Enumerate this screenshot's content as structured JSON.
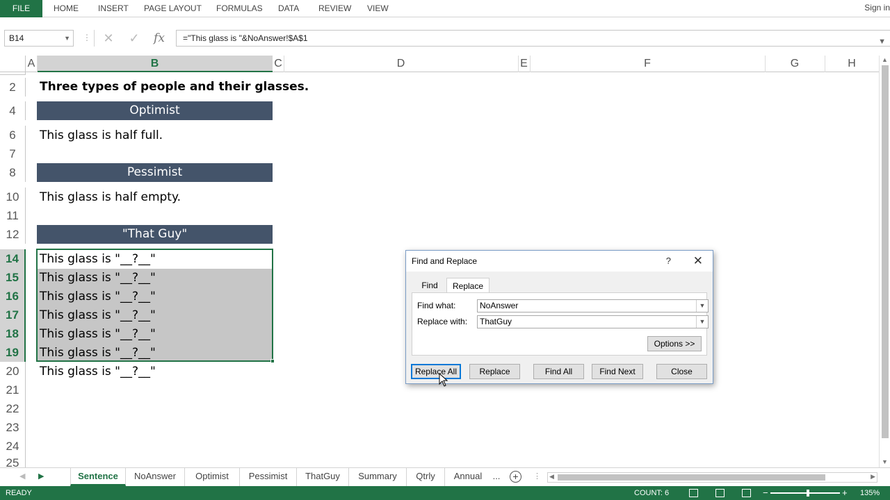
{
  "ribbon": {
    "file": "FILE",
    "tabs": [
      "HOME",
      "INSERT",
      "PAGE LAYOUT",
      "FORMULAS",
      "DATA",
      "REVIEW",
      "VIEW"
    ],
    "signin": "Sign in"
  },
  "formula_bar": {
    "name_box": "B14",
    "formula": "=\"This glass is \"&NoAnswer!$A$1",
    "fx": "fx"
  },
  "columns": [
    "A",
    "B",
    "C",
    "D",
    "E",
    "F",
    "G",
    "H"
  ],
  "rows": [
    "2",
    "4",
    "6",
    "7",
    "8",
    "10",
    "11",
    "12",
    "14",
    "15",
    "16",
    "17",
    "18",
    "19",
    "20",
    "21",
    "22",
    "23",
    "24",
    "25"
  ],
  "cells": {
    "title": "Three types of people and their glasses.",
    "optimist_header": "Optimist",
    "optimist_text": "This glass is half full.",
    "pessimist_header": "Pessimist",
    "pessimist_text": "This glass is half empty.",
    "thatguy_header": "\"That Guy\"",
    "thatguy_rows": [
      "This glass is \"__?__\"",
      "This glass is \"__?__\"",
      "This glass is \"__?__\"",
      "This glass is \"__?__\"",
      "This glass is \"__?__\"",
      "This glass is \"__?__\"",
      "This glass is \"__?__\""
    ]
  },
  "sheet_tabs": [
    "Sentence",
    "NoAnswer",
    "Optimist",
    "Pessimist",
    "ThatGuy",
    "Summary",
    "Qtrly",
    "Annual",
    "..."
  ],
  "status": {
    "ready": "READY",
    "count": "COUNT: 6",
    "zoom": "135%",
    "minus": "−",
    "plus": "+"
  },
  "dialog": {
    "title": "Find and Replace",
    "help": "?",
    "close_x": "✕",
    "tabs": [
      "Find",
      "Replace"
    ],
    "find_label": "Find what:",
    "find_value": "NoAnswer",
    "replace_label": "Replace with:",
    "replace_value": "ThatGuy",
    "options": "Options >>",
    "buttons": {
      "replace_all": "Replace All",
      "replace": "Replace",
      "find_all": "Find All",
      "find_next": "Find Next",
      "close": "Close"
    }
  },
  "colors": {
    "excel_green": "#217346",
    "header_band": "#44546a",
    "selection_shade": "#c6c6c6"
  }
}
